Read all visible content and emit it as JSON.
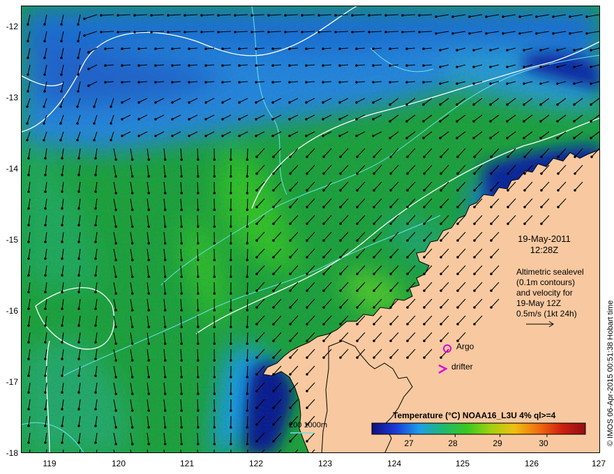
{
  "map": {
    "lat_ticks": [
      "-12",
      "-13",
      "-14",
      "-15",
      "-16",
      "-17",
      "-18"
    ],
    "lon_ticks": [
      "119",
      "120",
      "121",
      "122",
      "123",
      "124",
      "125",
      "126",
      "127"
    ],
    "lon_range": [
      118.6,
      127
    ],
    "lat_range": [
      -18,
      -11.7
    ],
    "colors": {
      "land": "#f8c9a0",
      "sst_cold": "#0a1a8a",
      "sst_blue": "#2a7be0",
      "sst_green": "#1faa3c",
      "sst_bright_green": "#3ccc2a",
      "contour_white": "#ffffff",
      "contour_cyan": "#6ee0e8",
      "argo_marker": "#e000e0"
    }
  },
  "overlay": {
    "date": "19-May-2011",
    "time": "12:28Z",
    "info_lines": [
      "Altimetric sealevel",
      "(0.1m contours)",
      "and velocity for",
      "19-May 12Z",
      "0.5m/s (1kt 24h)"
    ],
    "argo_label": "Argo",
    "drifter_label": "drifter",
    "depth_scale_label": "200  1000m"
  },
  "legend": {
    "title": "Temperature (°C) NOAA16_L3U 4% ql>=4",
    "tick_labels": [
      "27",
      "28",
      "29",
      "30"
    ],
    "colors": [
      "#10107a",
      "#1a3ad8",
      "#1e9ee8",
      "#20b870",
      "#38c820",
      "#a0d010",
      "#f0c010",
      "#f07010",
      "#d02010",
      "#901010"
    ]
  },
  "credit": "© IMOS 06-Apr-2015 00:51:38 Hobart time"
}
